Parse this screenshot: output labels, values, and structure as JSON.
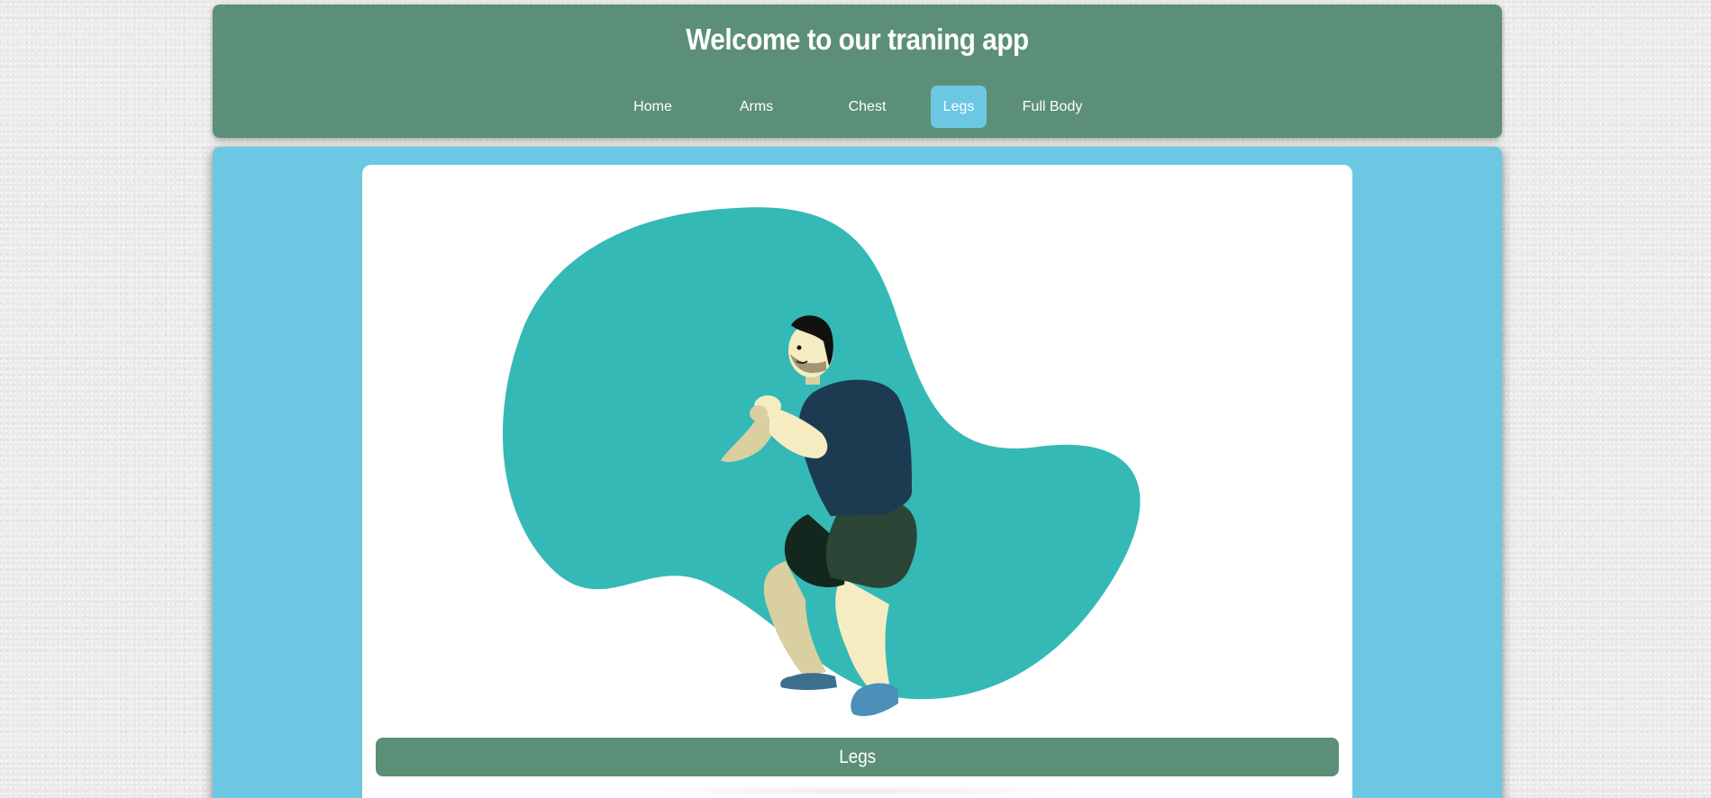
{
  "header": {
    "title": "Welcome to our traning app",
    "nav": [
      {
        "label": "Home"
      },
      {
        "label": "Arms"
      },
      {
        "label": "Chest"
      },
      {
        "label": "Legs",
        "active": true
      },
      {
        "label": "Full Body"
      }
    ]
  },
  "content": {
    "illustration_icon": "squat-figure-illustration",
    "caption": "Legs"
  },
  "colors": {
    "header_bg": "#5b8f78",
    "main_bg": "#6cc7e3",
    "active_tab": "#6cc7e3",
    "blob": "#35b9b6"
  }
}
